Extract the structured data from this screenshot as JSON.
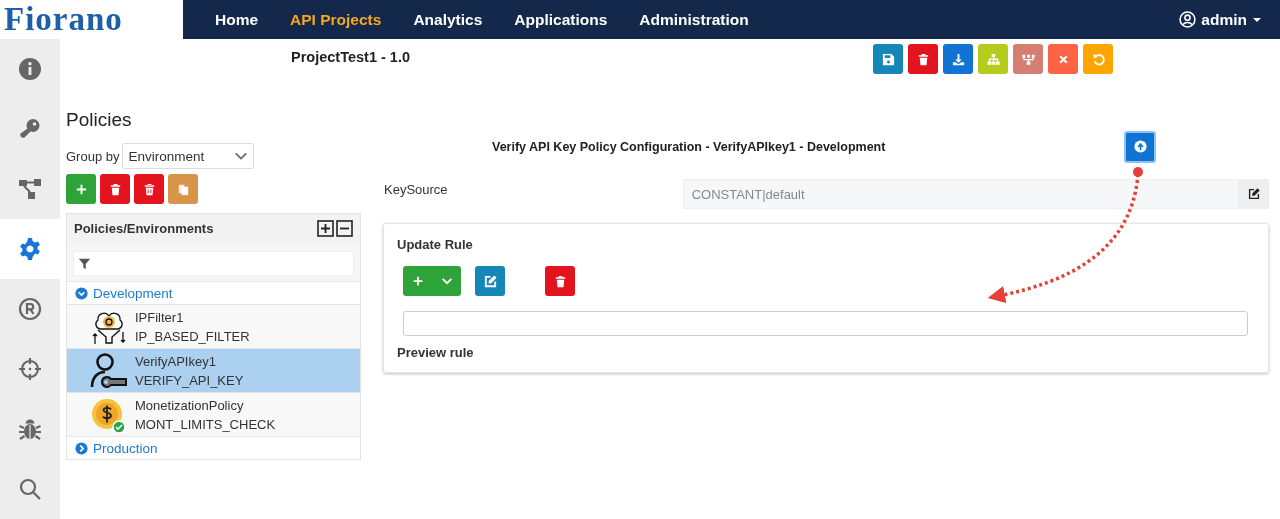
{
  "logo": "Fiorano",
  "nav": [
    {
      "label": "Home",
      "selected": false
    },
    {
      "label": "API Projects",
      "selected": true
    },
    {
      "label": "Analytics",
      "selected": false
    },
    {
      "label": "Applications",
      "selected": false
    },
    {
      "label": "Administration",
      "selected": false
    }
  ],
  "user": {
    "name": "admin"
  },
  "sidebar": {
    "items": [
      {
        "kind": "info",
        "selected": false
      },
      {
        "kind": "key",
        "selected": false
      },
      {
        "kind": "flow",
        "selected": false
      },
      {
        "kind": "gear",
        "selected": true
      },
      {
        "kind": "registered",
        "selected": false
      },
      {
        "kind": "target",
        "selected": false
      },
      {
        "kind": "bug",
        "selected": false
      },
      {
        "kind": "search",
        "selected": false
      }
    ]
  },
  "project": {
    "title": "ProjectTest1 - 1.0",
    "toolbar": [
      {
        "kind": "save"
      },
      {
        "kind": "delete"
      },
      {
        "kind": "download"
      },
      {
        "kind": "hierarchy"
      },
      {
        "kind": "tree"
      },
      {
        "kind": "close"
      },
      {
        "kind": "undo"
      }
    ]
  },
  "policies": {
    "title": "Policies",
    "group_by": {
      "label": "Group by",
      "value": "Environment"
    },
    "buttons": [
      {
        "kind": "add"
      },
      {
        "kind": "delete"
      },
      {
        "kind": "delete-all"
      },
      {
        "kind": "copy"
      }
    ],
    "tree": {
      "title": "Policies/Environments",
      "groups": [
        {
          "label": "Development",
          "expanded": true,
          "children": [
            {
              "name": "IPFilter1",
              "type": "IP_BASED_FILTER",
              "kind": "ip-filter",
              "selected": false
            },
            {
              "name": "VerifyAPIkey1",
              "type": "VERIFY_API_KEY",
              "kind": "api-key",
              "selected": true
            },
            {
              "name": "MonetizationPolicy",
              "type": "MONT_LIMITS_CHECK",
              "kind": "monetization",
              "selected": false
            }
          ]
        },
        {
          "label": "Production",
          "expanded": false
        }
      ]
    }
  },
  "config": {
    "title": "Verify API Key Policy Configuration - VerifyAPIkey1 - Development",
    "fields": [
      {
        "label": "KeySource",
        "value": "CONSTANT|default"
      }
    ],
    "rule": {
      "title": "Update Rule",
      "buttons": [
        {
          "kind": "add-dropdown"
        },
        {
          "kind": "edit"
        },
        {
          "kind": "delete"
        }
      ],
      "preview_label": "Preview rule"
    }
  }
}
